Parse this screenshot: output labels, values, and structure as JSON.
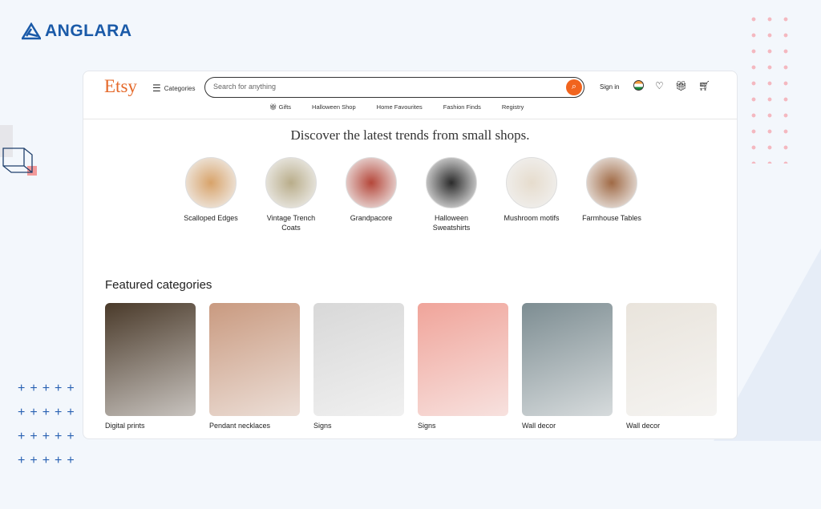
{
  "brand": {
    "name": "ANGLARA"
  },
  "etsy": {
    "logo": "Etsy",
    "categories": "Categories",
    "search_placeholder": "Search for anything",
    "sign_in": "Sign in",
    "nav": [
      "Gifts",
      "Halloween Shop",
      "Home Favourites",
      "Fashion Finds",
      "Registry"
    ],
    "heading": "Discover the latest trends from small shops.",
    "trends": [
      {
        "label": "Scalloped Edges",
        "color": "#d8a36a"
      },
      {
        "label": "Vintage Trench Coats",
        "color": "#b9ad8a"
      },
      {
        "label": "Grandpacore",
        "color": "#b5473a"
      },
      {
        "label": "Halloween Sweatshirts",
        "color": "#2b2b2b"
      },
      {
        "label": "Mushroom motifs",
        "color": "#e6dccd"
      },
      {
        "label": "Farmhouse Tables",
        "color": "#a06a45"
      }
    ],
    "featured_title": "Featured categories",
    "featured": [
      {
        "label": "Digital prints",
        "color": "#4a3a2a"
      },
      {
        "label": "Pendant necklaces",
        "color": "#c99a80"
      },
      {
        "label": "Signs",
        "color": "#d8d8d8"
      },
      {
        "label": "Signs",
        "color": "#f0a49a"
      },
      {
        "label": "Wall decor",
        "color": "#7d8d92"
      },
      {
        "label": "Wall decor",
        "color": "#e9e4dc"
      }
    ]
  },
  "colors": {
    "accent": "#f1641e",
    "brand": "#1a5aa8"
  }
}
